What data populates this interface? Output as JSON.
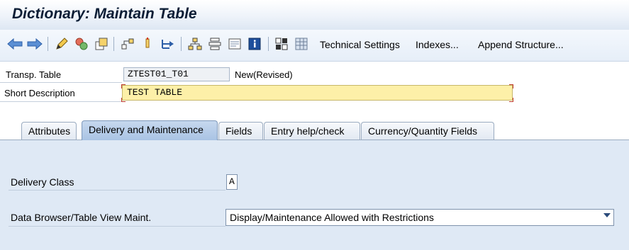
{
  "window": {
    "title": "Dictionary: Maintain Table"
  },
  "toolbar": {
    "icons": [
      "back-arrow-icon",
      "forward-arrow-icon",
      "edit-pencil-icon",
      "activate-icon",
      "object-list-icon",
      "where-used-icon",
      "navigation-icon",
      "hierarchy-icon",
      "tree-icon",
      "layout-icon",
      "info-icon",
      "grid-icon",
      "table-icon"
    ],
    "technical_settings": "Technical Settings",
    "indexes": "Indexes...",
    "append_structure": "Append Structure..."
  },
  "header": {
    "transp_table_label": "Transp. Table",
    "transp_table_value": "ZTEST01_T01",
    "status": "New(Revised)",
    "short_description_label": "Short Description",
    "short_description_value": "TEST TABLE"
  },
  "tabs": [
    {
      "label": "Attributes",
      "active": false
    },
    {
      "label": "Delivery and Maintenance",
      "active": true
    },
    {
      "label": "Fields",
      "active": false
    },
    {
      "label": "Entry help/check",
      "active": false
    },
    {
      "label": "Currency/Quantity Fields",
      "active": false
    }
  ],
  "panel": {
    "delivery_class_label": "Delivery Class",
    "delivery_class_value": "A",
    "data_browser_label": "Data Browser/Table View Maint.",
    "data_browser_value": "Display/Maintenance Allowed with Restrictions"
  },
  "colors": {
    "accent": "#a9c3e4",
    "required_field": "#fdf0a8",
    "panel_bg": "#dfe9f5"
  }
}
